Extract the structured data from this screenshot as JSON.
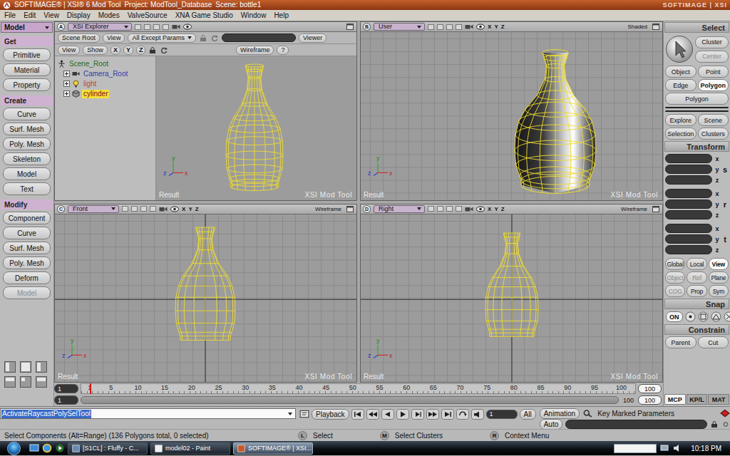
{
  "window": {
    "app": "SOFTIMAGE® | XSI® 6 Mod Tool",
    "project": "Project: ModTool_Database",
    "scene": "Scene: bottle1",
    "logo": "SOFTIMAGE | XSI"
  },
  "menu": [
    "File",
    "Edit",
    "View",
    "Display",
    "Modes",
    "ValveSource",
    "XNA Game Studio",
    "Window",
    "Help"
  ],
  "left_panel": {
    "mode": "Model",
    "sections": [
      {
        "title": "Get",
        "buttons": [
          {
            "label": "Primitive",
            "disabled": false
          },
          {
            "label": "Material",
            "disabled": false
          },
          {
            "label": "Property",
            "disabled": false
          }
        ]
      },
      {
        "title": "Create",
        "buttons": [
          {
            "label": "Curve",
            "disabled": false
          },
          {
            "label": "Surf. Mesh",
            "disabled": false
          },
          {
            "label": "Poly. Mesh",
            "disabled": false
          },
          {
            "label": "Skeleton",
            "disabled": false
          },
          {
            "label": "Model",
            "disabled": false
          },
          {
            "label": "Text",
            "disabled": false
          }
        ]
      },
      {
        "title": "Modify",
        "buttons": [
          {
            "label": "Component",
            "disabled": false
          },
          {
            "label": "Curve",
            "disabled": false
          },
          {
            "label": "Surf. Mesh",
            "disabled": false
          },
          {
            "label": "Poly. Mesh",
            "disabled": false
          },
          {
            "label": "Deform",
            "disabled": false
          },
          {
            "label": "Model",
            "disabled": true
          }
        ]
      }
    ]
  },
  "explorer": {
    "letter": "A",
    "name": "XSI Explorer",
    "scope": "Scene Root",
    "view": "View",
    "filter": "All Except Params",
    "viewer": "Viewer",
    "row2": {
      "view": "View",
      "show": "Show",
      "axes": [
        "X",
        "Y",
        "Z"
      ],
      "mode": "Wireframe",
      "help": "?"
    },
    "tree": {
      "label": "Scene_Root",
      "kind": "root",
      "expanded": true,
      "selected": false,
      "color": "#1f6b1f",
      "children": [
        {
          "label": "Camera_Root",
          "kind": "camera",
          "expanded": false,
          "selected": false,
          "color": "#2b3fa8"
        },
        {
          "label": "light",
          "kind": "light",
          "expanded": false,
          "selected": false,
          "color": "#c0482a"
        },
        {
          "label": "cylinder",
          "kind": "mesh",
          "expanded": false,
          "selected": true,
          "color": "#7a1010"
        }
      ]
    },
    "result": "Result",
    "brand": "XSI Mod Tool",
    "gizmo": {
      "y": "y",
      "z": "z",
      "x": "x"
    }
  },
  "viewports": [
    {
      "letter": "B",
      "name": "User",
      "axes": "X Y Z",
      "mode": "Shaded",
      "shaded": true,
      "result": "Result",
      "brand": "XSI Mod Tool",
      "gizmo": {
        "y": "y",
        "z": "z",
        "x": "x"
      }
    },
    {
      "letter": "C",
      "name": "Front",
      "axes": "X Y Z",
      "mode": "Wireframe",
      "shaded": false,
      "result": "Result",
      "brand": "XSI Mod Tool",
      "gizmo": {
        "y": "y",
        "z": "z",
        "x": "x"
      }
    },
    {
      "letter": "D",
      "name": "Right",
      "axes": "X Y Z",
      "mode": "Wireframe",
      "shaded": false,
      "result": "Result",
      "brand": "XSI Mod Tool",
      "gizmo": {
        "y": "y",
        "z": "z",
        "x": "x"
      }
    }
  ],
  "timeline": {
    "start": "1",
    "end": "100",
    "ticks": [
      "1",
      "5",
      "10",
      "15",
      "20",
      "25",
      "30",
      "35",
      "40",
      "45",
      "50",
      "55",
      "60",
      "65",
      "70",
      "75",
      "80",
      "85",
      "90",
      "95",
      "100"
    ],
    "playhead_level": 0,
    "range_start": "1",
    "range_end": "100",
    "range_end_field": "100"
  },
  "right_panel": {
    "select": {
      "title": "Select",
      "side_buttons": [
        {
          "label": "Cluster",
          "disabled": false
        },
        {
          "label": "Center",
          "disabled": true
        }
      ],
      "components": [
        {
          "label": "Object",
          "selected": false
        },
        {
          "label": "Point",
          "selected": false
        },
        {
          "label": "Edge",
          "selected": false
        },
        {
          "label": "Polygon",
          "selected": true
        }
      ],
      "filter": "Polygon",
      "extra": [
        "Explore",
        "Scene",
        "Selection",
        "Clusters"
      ]
    },
    "transform": {
      "title": "Transform",
      "groups": [
        {
          "letter": "s",
          "axes": [
            "x",
            "y",
            "z"
          ]
        },
        {
          "letter": "r",
          "axes": [
            "x",
            "y",
            "z"
          ]
        },
        {
          "letter": "t",
          "axes": [
            "x",
            "y",
            "z"
          ]
        }
      ],
      "spaces": [
        {
          "label": "Global",
          "selected": false
        },
        {
          "label": "Local",
          "selected": false
        },
        {
          "label": "View",
          "selected": true
        }
      ],
      "refs": [
        {
          "label": "Object",
          "disabled": true
        },
        {
          "label": "Ref",
          "disabled": true
        },
        {
          "label": "Plane",
          "disabled": false
        }
      ],
      "options": [
        {
          "label": "COG",
          "disabled": true
        },
        {
          "label": "Prop",
          "disabled": false
        },
        {
          "label": "Sym",
          "disabled": false
        }
      ]
    },
    "snap": {
      "title": "Snap",
      "on": "ON"
    },
    "constrain": {
      "title": "Constrain",
      "buttons": [
        "Parent",
        "Cut"
      ]
    },
    "tabs": [
      {
        "label": "MCP",
        "selected": true
      },
      {
        "label": "KP/L",
        "selected": false
      },
      {
        "label": "MAT",
        "selected": false
      }
    ]
  },
  "command_bar": {
    "command": "ActivateRaycastPolySelTool",
    "playback": "Playback",
    "frame": "1",
    "all": "All",
    "animation": "Animation",
    "auto": "Auto",
    "key": "Key Marked Parameters"
  },
  "status_bar": {
    "message": "Select Components (Alt=Range) (136 Polygons total, 0 selected)",
    "hints": [
      {
        "key": "L",
        "action": "Select"
      },
      {
        "key": "M",
        "action": "Select Clusters"
      },
      {
        "key": "R",
        "action": "Context Menu"
      }
    ]
  },
  "taskbar": {
    "items": [
      {
        "label": "[S1CL] : Fluffy - C...",
        "selected": false
      },
      {
        "label": "model02 - Paint",
        "selected": false
      },
      {
        "label": "SOFTIMAGE® | XSI...",
        "selected": true
      }
    ],
    "clock": "10:18 PM"
  }
}
